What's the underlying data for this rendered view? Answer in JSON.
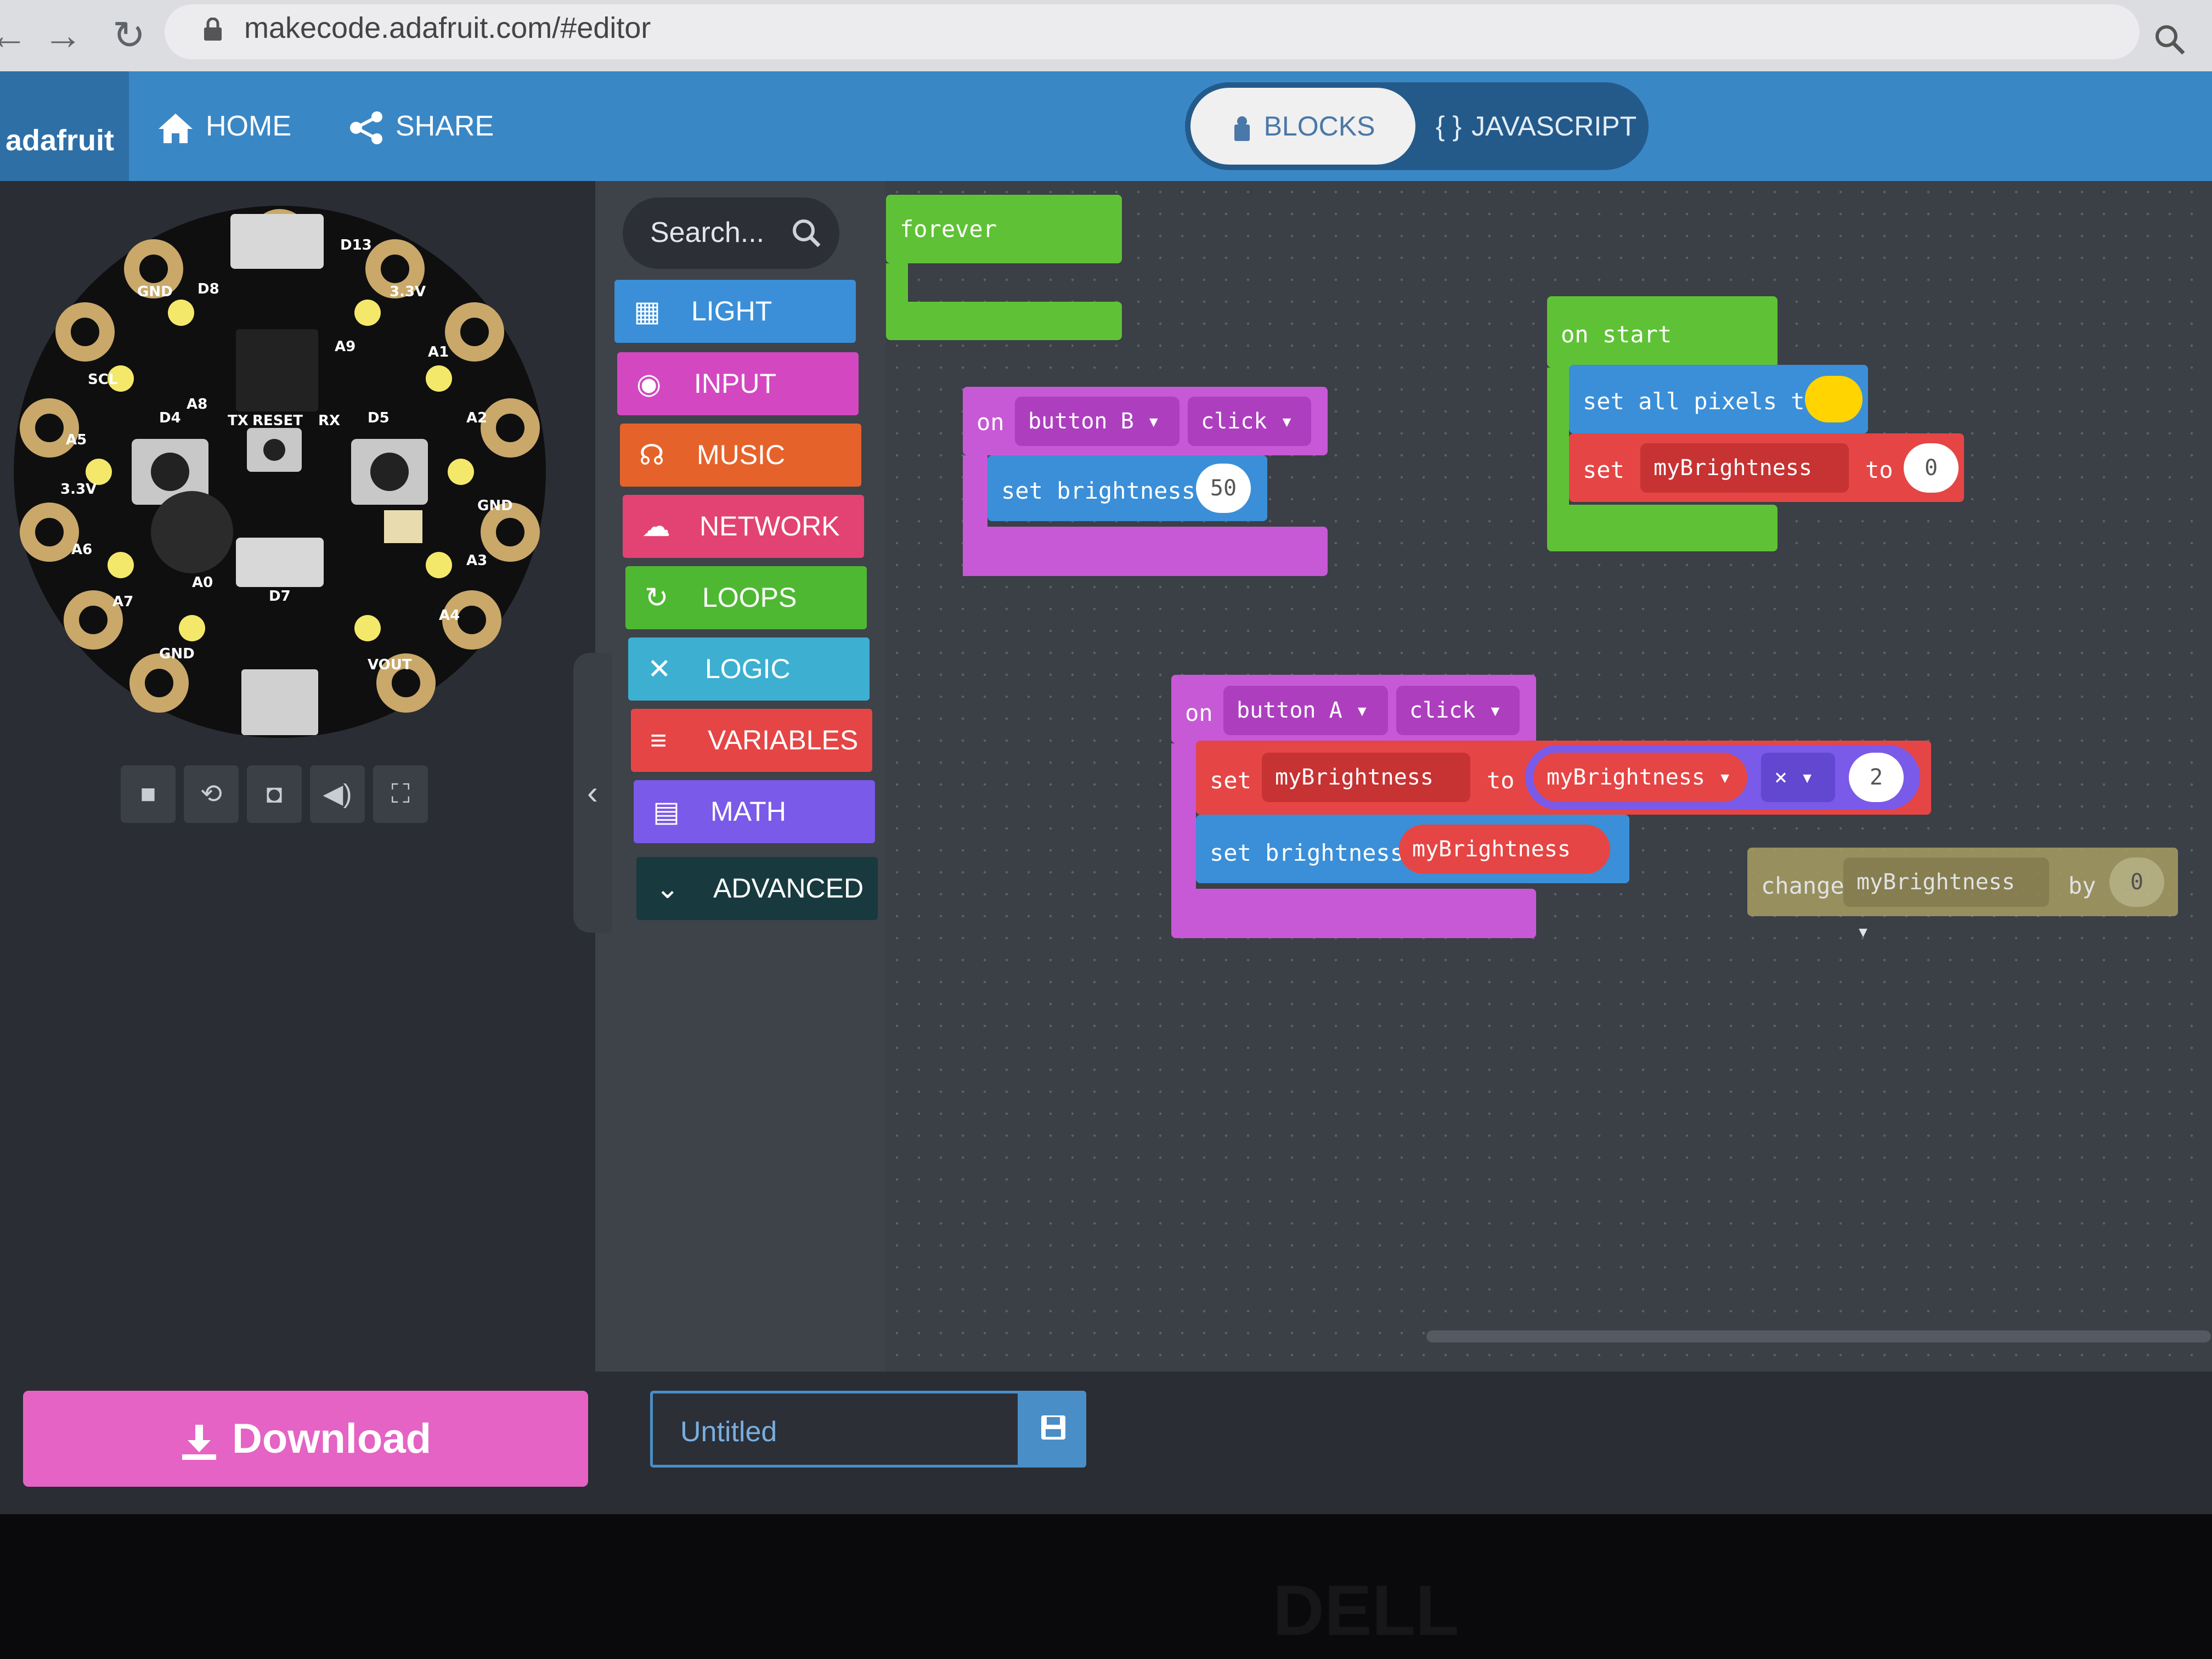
{
  "browser": {
    "url": "makecode.adafruit.com/#editor",
    "back_icon": "back-arrow-icon",
    "forward_icon": "forward-arrow-icon",
    "reload_icon": "reload-icon",
    "lock_icon": "lock-icon",
    "zoom_icon": "zoom-icon"
  },
  "header": {
    "logo": "adafruit",
    "home_label": "HOME",
    "share_label": "SHARE",
    "blocks_label": "BLOCKS",
    "javascript_label": "JAVASCRIPT",
    "javascript_prefix": "{ }"
  },
  "simulator": {
    "controls": [
      "stop-icon",
      "restart-icon",
      "screenshot-icon",
      "sound-icon",
      "fullscreen-icon"
    ],
    "pin_labels": [
      "D13",
      "3.3V",
      "A1",
      "A2",
      "GND",
      "A3",
      "A4",
      "VOUT",
      "GND",
      "A7",
      "A6",
      "3.3V",
      "A5",
      "SCL",
      "GND",
      "D8",
      "A9",
      "A8",
      "D4",
      "D5",
      "D7",
      "A0",
      "RESET",
      "TX",
      "RX"
    ],
    "led_color": "#f4e86a"
  },
  "download": {
    "label": "Download"
  },
  "toolbox": {
    "search_placeholder": "Search...",
    "categories": [
      {
        "label": "LIGHT",
        "color": "#3a8fd8"
      },
      {
        "label": "INPUT",
        "color": "#d348c1"
      },
      {
        "label": "MUSIC",
        "color": "#e5632a"
      },
      {
        "label": "NETWORK",
        "color": "#e24372"
      },
      {
        "label": "LOOPS",
        "color": "#4fb833"
      },
      {
        "label": "LOGIC",
        "color": "#3dafd1"
      },
      {
        "label": "VARIABLES",
        "color": "#e64545"
      },
      {
        "label": "MATH",
        "color": "#7a5ae8"
      },
      {
        "label": "ADVANCED",
        "color": "#183a3f"
      }
    ]
  },
  "blocks": {
    "forever": {
      "label": "forever",
      "color": "#5fc236"
    },
    "on_start": {
      "label": "on start",
      "set_all_pixels": "set all pixels to",
      "pixel_color": "#ffd400",
      "set": "set",
      "var": "myBrightness",
      "to": "to",
      "value": "0"
    },
    "on_button_b": {
      "on": "on",
      "button": "button B",
      "event": "click",
      "set_brightness": "set brightness",
      "value": "50"
    },
    "on_button_a": {
      "on": "on",
      "button": "button A",
      "event": "click",
      "set": "set",
      "var": "myBrightness",
      "to": "to",
      "var2": "myBrightness",
      "op": "×",
      "value": "2",
      "set_brightness": "set brightness",
      "var3": "myBrightness"
    },
    "change": {
      "change": "change",
      "var": "myBrightness",
      "by": "by",
      "value": "0"
    }
  },
  "project": {
    "name": "Untitled",
    "save_icon": "save-icon"
  },
  "bezel": {
    "brand": "DELL"
  }
}
